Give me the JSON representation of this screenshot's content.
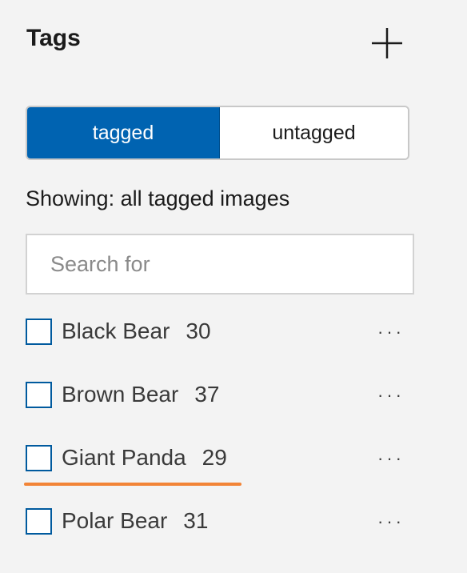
{
  "header": {
    "title": "Tags",
    "add_icon": "plus-icon"
  },
  "toggle": {
    "tagged_label": "tagged",
    "untagged_label": "untagged",
    "selected": "tagged"
  },
  "showing_text": "Showing: all tagged images",
  "search": {
    "placeholder": "Search for",
    "value": ""
  },
  "tags": [
    {
      "name": "Black Bear",
      "count": "30"
    },
    {
      "name": "Brown Bear",
      "count": "37"
    },
    {
      "name": "Giant Panda",
      "count": "29"
    },
    {
      "name": "Polar Bear",
      "count": "31"
    }
  ],
  "more_icon": "more-horizontal-icon",
  "colors": {
    "accent": "#0063b1",
    "checkbox_border": "#005a9e",
    "underline": "#f28436",
    "panel_bg": "#f3f3f3"
  }
}
